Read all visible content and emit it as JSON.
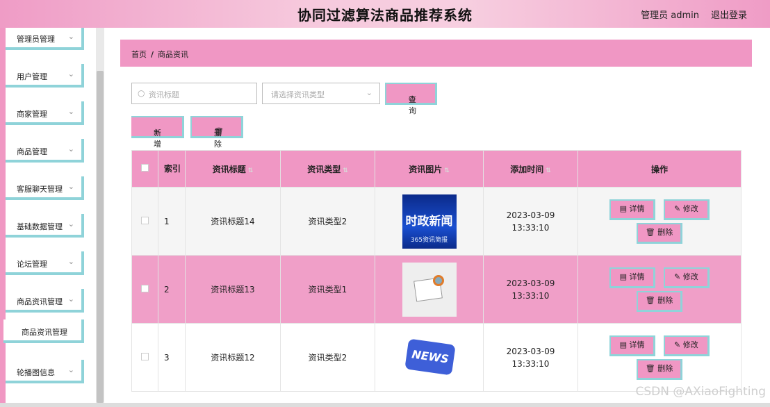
{
  "header": {
    "title": "协同过滤算法商品推荐系统",
    "user": "管理员 admin",
    "logout": "退出登录"
  },
  "sidebar": {
    "items": [
      {
        "label": "管理员管理"
      },
      {
        "label": "用户管理"
      },
      {
        "label": "商家管理"
      },
      {
        "label": "商品管理"
      },
      {
        "label": "客服聊天管理"
      },
      {
        "label": "基础数据管理"
      },
      {
        "label": "论坛管理"
      },
      {
        "label": "商品资讯管理"
      },
      {
        "label": "轮播图信息"
      }
    ],
    "submenu": {
      "label": "商品资讯管理"
    }
  },
  "breadcrumb": {
    "home": "首页",
    "sep": "/",
    "current": "商品资讯"
  },
  "search": {
    "placeholder": "资讯标题",
    "type_placeholder": "请选择资讯类型",
    "query_label": "查询"
  },
  "actions": {
    "add_label": "新增",
    "delete_label": "删除"
  },
  "table": {
    "headers": {
      "index": "索引",
      "title": "资讯标题",
      "type": "资讯类型",
      "image": "资讯图片",
      "time": "添加时间",
      "ops": "操作"
    },
    "rows": [
      {
        "index": "1",
        "title": "资讯标题14",
        "type": "资讯类型2",
        "image_text": "时政新闻",
        "image_sub": "365资讯简报",
        "time": "2023-03-09 13:33:10"
      },
      {
        "index": "2",
        "title": "资讯标题13",
        "type": "资讯类型1",
        "image_text": "NEWS",
        "time": "2023-03-09 13:33:10"
      },
      {
        "index": "3",
        "title": "资讯标题12",
        "type": "资讯类型2",
        "image_text": "NEWS",
        "time": "2023-03-09 13:33:10"
      }
    ],
    "op_labels": {
      "detail": "详情",
      "edit": "修改",
      "delete": "删除"
    }
  },
  "watermark": "CSDN @AXiaoFighting"
}
